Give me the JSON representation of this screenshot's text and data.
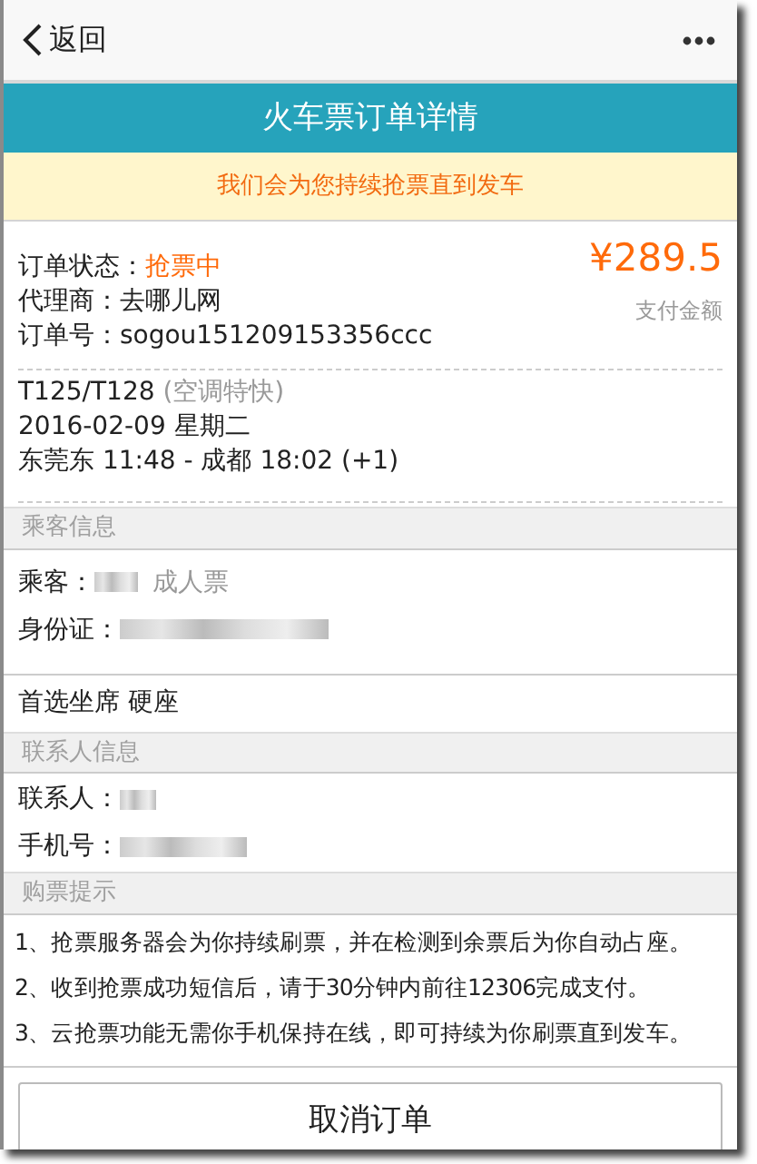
{
  "nav": {
    "back": "返回"
  },
  "title": "火车票订单详情",
  "notice": "我们会为您持续抢票直到发车",
  "order": {
    "status_label": "订单状态：",
    "status": "抢票中",
    "agent_label": "代理商：",
    "agent": "去哪儿网",
    "number_label": "订单号：",
    "number": "sogou151209153356ccc",
    "price": "¥289.5",
    "price_label": "支付金额"
  },
  "train": {
    "number": "T125/T128",
    "type": "(空调特快)",
    "date": "2016-02-09 星期二",
    "route": "东莞东 11:48 - 成都 18:02 (+1)"
  },
  "passenger": {
    "heading": "乘客信息",
    "rows": [
      {
        "label": "乘客：",
        "blurred": true,
        "note": "成人票"
      },
      {
        "label": "身份证：",
        "blurred": true
      }
    ]
  },
  "seat": "首选坐席 硬座",
  "contact": {
    "heading": "联系人信息",
    "rows": [
      {
        "label": "联系人：",
        "blurred": true
      },
      {
        "label": "手机号：",
        "blurred": true
      }
    ]
  },
  "tips": {
    "heading": "购票提示",
    "items": [
      "1、抢票服务器会为你持续刷票，并在检测到余票后为你自动占座。",
      "2、收到抢票成功短信后，请于30分钟内前往12306完成支付。",
      "3、云抢票功能无需你手机保持在线，即可持续为你刷票直到发车。"
    ]
  },
  "button": "取消订单"
}
